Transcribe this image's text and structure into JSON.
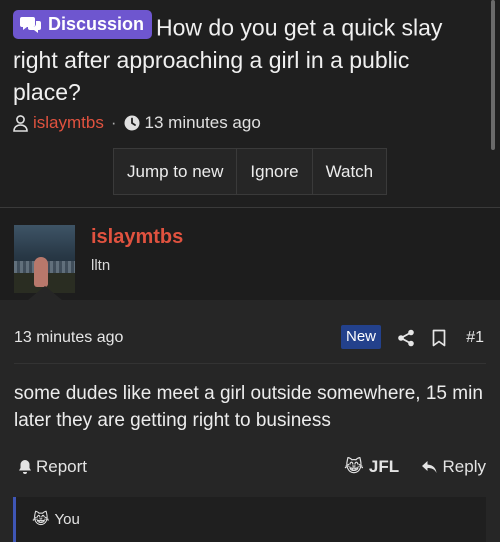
{
  "thread": {
    "badge_label": "Discussion",
    "title": "How do you get a quick slay right after approaching a girl in a public place?",
    "author": "islaymtbs",
    "separator": "·",
    "time": "13 minutes ago",
    "buttons": {
      "jump": "Jump to new",
      "ignore": "Ignore",
      "watch": "Watch"
    }
  },
  "user": {
    "name": "islaymtbs",
    "title": "lltn"
  },
  "post": {
    "time": "13 minutes ago",
    "new_badge": "New",
    "number": "#1",
    "body": "some dudes like meet a girl outside somewhere, 15 min later they are getting right to business",
    "report_label": "Report",
    "reaction_label": "JFL",
    "reaction_emoji": "😹",
    "reply_label": "Reply",
    "reactions_list_label": "You",
    "reactions_list_emoji": "😹"
  },
  "colors": {
    "accent_purple": "#6e56cf",
    "author_red": "#e0523f",
    "new_blue": "#23418c",
    "reactions_border": "#3f56b5"
  },
  "icons": [
    "chat-bubbles-icon",
    "user-icon",
    "clock-icon",
    "share-icon",
    "bookmark-icon",
    "bell-icon",
    "reply-icon",
    "joy-cat-emoji"
  ]
}
